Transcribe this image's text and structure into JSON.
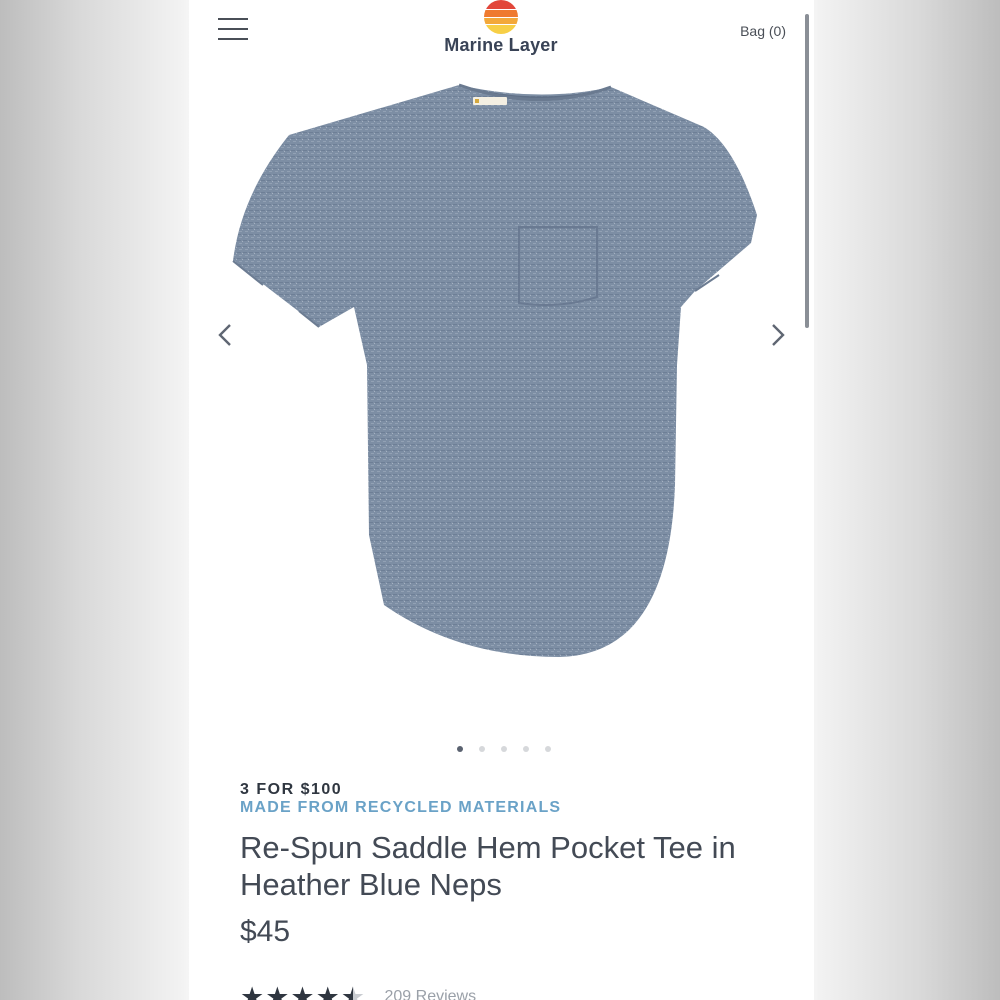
{
  "header": {
    "brand": "Marine Layer",
    "bag_label": "Bag (0)",
    "menu_icon": "hamburger-menu-icon",
    "logo_icon": "sunset-logo-icon",
    "logo_colors": [
      "#e2463a",
      "#ef7a2f",
      "#f3a83a",
      "#f7cf46"
    ]
  },
  "gallery": {
    "image_alt": "Heather blue crew neck tee with chest pocket",
    "prev_icon": "chevron-left-icon",
    "next_icon": "chevron-right-icon",
    "slide_count": 5,
    "active_slide": 1
  },
  "product": {
    "promo": "3 FOR $100",
    "material_tag": "MADE FROM RECYCLED MATERIALS",
    "title": "Re-Spun Saddle Hem Pocket Tee in Heather Blue Neps",
    "price": "$45",
    "rating": 4.5,
    "reviews_label": "209 Reviews"
  },
  "colors": {
    "promo_text": "#2f3640",
    "material_tag": "#6aa2c7",
    "title_text": "#434a55",
    "shirt": "#7d8ea4"
  }
}
